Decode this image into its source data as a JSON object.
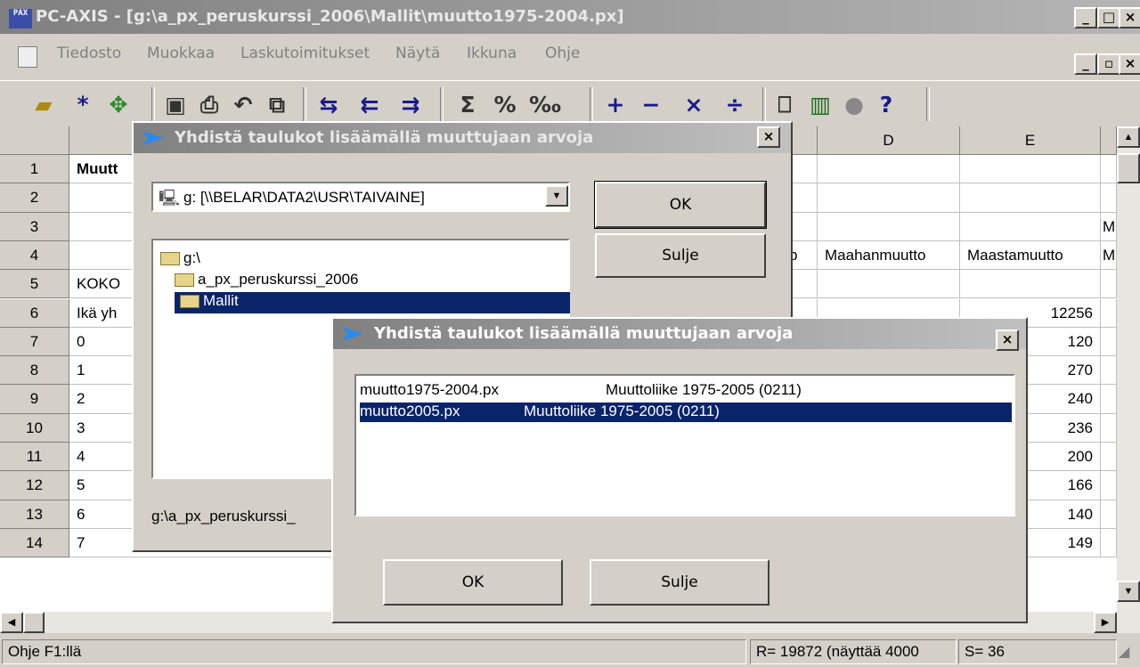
{
  "window": {
    "title": "PC-AXIS - [g:\\a_px_peruskurssi_2006\\Mallit\\muutto1975-2004.px]",
    "icon_text": "PAX"
  },
  "menu": [
    "Tiedosto",
    "Muokkaa",
    "Laskutoimitukset",
    "Näytä",
    "Ikkuna",
    "Ohje"
  ],
  "toolbar_icons": [
    "open-icon",
    "asterisk-icon",
    "move-icon",
    "save-icon",
    "print-icon",
    "undo-icon",
    "copy-icon",
    "pivot-icon",
    "pivot-left-icon",
    "pivot-right-icon",
    "sum-icon",
    "percent-icon",
    "permille-icon",
    "plus-icon",
    "minus-icon",
    "multiply-icon",
    "divide-icon",
    "book-icon",
    "chart-icon",
    "circle-icon",
    "help-icon"
  ],
  "toolbar_glyphs": [
    "+",
    "−",
    "×",
    "÷",
    "Σ",
    "%",
    "‰",
    "?"
  ],
  "grid": {
    "columns": [
      "D",
      "E"
    ],
    "row_numbers": [
      "1",
      "2",
      "3",
      "4",
      "5",
      "6",
      "7",
      "8",
      "9",
      "10",
      "11",
      "12",
      "13",
      "14"
    ],
    "col_b_cells": [
      "Muutt",
      "",
      "",
      "",
      "KOKO",
      "Ikä yh",
      "0",
      "1",
      "2",
      "3",
      "4",
      "5",
      "6",
      "7"
    ],
    "col_c_partial_row4": "b",
    "row4_d": "Maahanmuutto",
    "row4_e": "Maastamuutto",
    "col_f_partial": [
      "M",
      "M"
    ],
    "col_e_values": [
      "12256",
      "120",
      "270",
      "240",
      "236",
      "200",
      "166",
      "140",
      "149"
    ]
  },
  "status": {
    "help": "Ohje F1:llä",
    "rows": "R= 19872  (näyttää 4000",
    "cols": "S= 36"
  },
  "dialog_back": {
    "title": "Yhdistä taulukot lisäämällä muuttujaan arvoja",
    "drive": "g: [\\\\BELAR\\DATA2\\USR\\TAIVAINE]",
    "folders": [
      "g:\\",
      "a_px_peruskurssi_2006",
      "Mallit"
    ],
    "path": "g:\\a_px_peruskurssi_",
    "ok": "OK",
    "close": "Sulje"
  },
  "dialog_front": {
    "title": "Yhdistä taulukot lisäämällä muuttujaan arvoja",
    "files": [
      {
        "name": "muutto1975-2004.px",
        "desc": "Muuttoliike 1975-2005 (0211)"
      },
      {
        "name": "muutto2005.px",
        "desc": "Muuttoliike 1975-2005 (0211)"
      }
    ],
    "ok": "OK",
    "close": "Sulje"
  },
  "colors": {
    "selection": "#0a246a",
    "face": "#d4d0c8"
  }
}
